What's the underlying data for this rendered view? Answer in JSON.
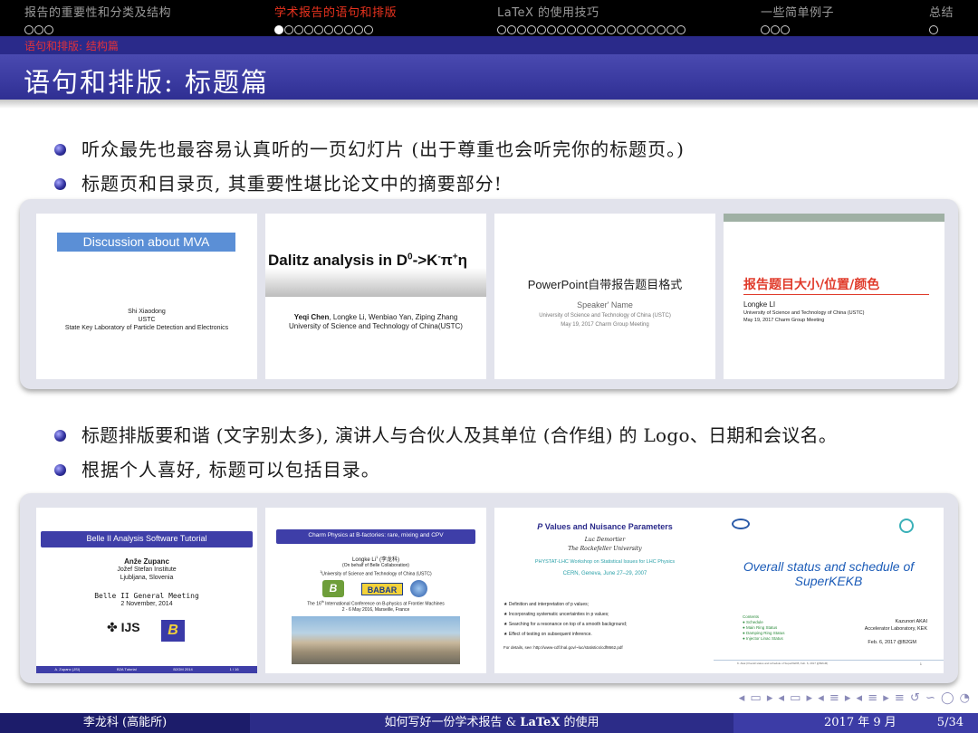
{
  "nav": {
    "sections": [
      {
        "title": "报告的重要性和分类及结构",
        "dots": 3,
        "filled": []
      },
      {
        "title": "学术报告的语句和排版",
        "dots": 10,
        "filled": [
          0,
          1
        ]
      },
      {
        "title": "LaTeX 的使用技巧",
        "dots": 19,
        "filled": []
      },
      {
        "title": "一些简单例子",
        "dots": 3,
        "filled": []
      },
      {
        "title": "总结",
        "dots": 1,
        "filled": []
      }
    ],
    "subsection": "语句和排版: 结构篇"
  },
  "frame_title": "语句和排版: 标题篇",
  "bullets_top": [
    "听众最先也最容易认真听的一页幻灯片 (出于尊重也会听完你的标题页。)",
    "标题页和目录页, 其重要性堪比论文中的摘要部分!"
  ],
  "bullets_bottom": [
    "标题排版要和谐 (文字别太多), 演讲人与合伙人及其单位 (合作组) 的 Logo、日期和会议名。",
    "根据个人喜好, 标题可以包括目录。"
  ],
  "row1": {
    "card1": {
      "title": "Discussion about MVA",
      "name": "Shi Xiaodong",
      "org1": "USTC",
      "org2": "State Key Laboratory of Particle Detection and Electronics"
    },
    "card2": {
      "title": "Dalitz analysis in D",
      "title_sup": "0",
      "title_tail": "->K",
      "title_sup2": "-",
      "title_pi": "π",
      "title_sup3": "+",
      "title_eta": "η",
      "authors_lead": "Yeqi Chen",
      "authors_rest": ", Longke Li, Wenbiao Yan, Ziping Zhang",
      "org": "University of Science and Technology of China(USTC)"
    },
    "card3": {
      "title": "PowerPoint自带报告题目格式",
      "speaker": "Speaker' Name",
      "org": "University of Science and Technology of China (USTC)",
      "date": "May 19, 2017  Charm Group Meeting"
    },
    "card4": {
      "title": "报告题目大小/位置/颜色",
      "name": "Longke LI",
      "org": "University of Science and Technology of China (USTC)",
      "date": "May 19, 2017  Charm Group Meeting"
    }
  },
  "row2": {
    "card1": {
      "title": "Belle II Analysis Software Tutorial",
      "name": "Anže Zupanc",
      "org1": "Jožef Stefan Institute",
      "org2": "Ljubljana, Slovenia",
      "meeting": "Belle II General Meeting",
      "date": "2 November, 2014",
      "logo1": "IJS",
      "logo2": "B",
      "foot1": "A. Zupanc (JSI)",
      "foot2": "B2A Tutorial",
      "foot3": "B2GM 2014",
      "foot4": "1 / 16"
    },
    "card2": {
      "title": "Charm Physics at B-factories: rare, mixing and CPV",
      "name": "Longke Li",
      "name_sup": "1",
      "name_zh": "(李龙科)",
      "behalf": "(On behalf of Belle Collaboration)",
      "org_sup": "1",
      "org": "University of Science and Technology of China (USTC)",
      "logo1": "B",
      "logo2": "BABAR",
      "conf_pre": "The 16",
      "conf_sup": "th",
      "conf_post": " International Conference on B-physics at Frontier Machines",
      "conf_date": "2 - 6 May 2016, Marseille, France"
    },
    "card3": {
      "title_p": "P",
      "title": " Values and Nuisance Parameters",
      "name": "Luc Demortier",
      "org": "The Rockefeller University",
      "workshop": "PHYSTAT-LHC Workshop on Statistical Issues for LHC Physics",
      "place": "CERN, Geneva, June 27–29, 2007",
      "items": [
        "Definition and interpretation of p values;",
        "Incorporating systematic uncertainties in p values;",
        "Searching for a resonance on top of a smooth background;",
        "Effect of testing on subsequent inference."
      ],
      "details": "For details, see: http://www-cdf.fnal.gov/~luc/statistics/cdf8662.pdf"
    },
    "card4": {
      "title": "Overall status and schedule of SuperKEKB",
      "contents_label": "Contents",
      "contents": [
        "Schedule",
        "Main Ring Status",
        "Damping Ring Status",
        "Injector Linac Status"
      ],
      "name": "Kazunori AKAI",
      "org": "Accelerator Laboratory, KEK",
      "date": "Feb. 6, 2017 @B2GM",
      "foot": "K. Akai (Overall status and schedule of SuperKEKB, Feb. 6, 2017 @B2GM)",
      "page": "1"
    }
  },
  "nav_symbols": "◂ ▭ ▸ ◂ ▭ ▸ ◂ ≡ ▸ ◂ ≡ ▸ ≡ ↺ ∽ ◯ ◔",
  "footer": {
    "author": "李龙科 (高能所)",
    "title_pre": "如何写好一份学术报告 & ",
    "title_bold": "LaTeX",
    "title_post": " 的使用",
    "date": "2017 年 9 月",
    "page": "5/34"
  },
  "colors": {
    "accent": "#3a3aa0",
    "nav_active": "#e8321e",
    "subsection": "#e0323a",
    "card_title_blue": "#5b8fd6"
  }
}
